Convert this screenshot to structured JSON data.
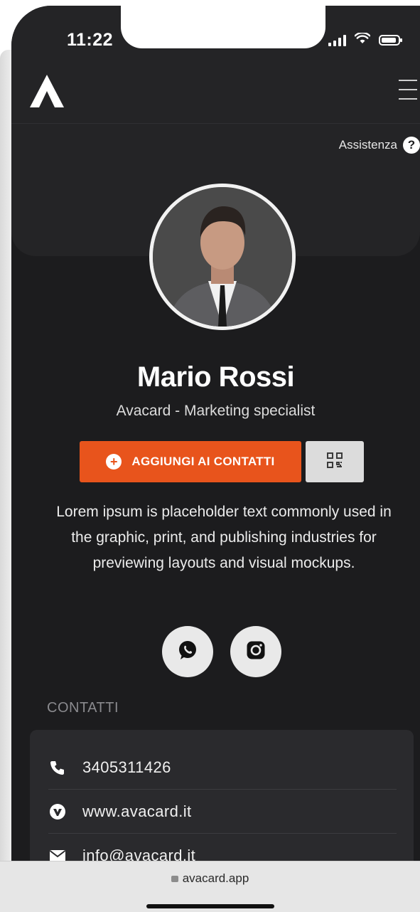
{
  "status_bar": {
    "time": "11:22"
  },
  "header": {
    "help_label": "Assistenza",
    "help_glyph": "?"
  },
  "profile": {
    "name": "Mario Rossi",
    "subtitle": "Avacard - Marketing specialist",
    "add_contact_label": "AGGIUNGI AI CONTATTI",
    "bio": "Lorem ipsum is placeholder text commonly used in the graphic, print, and publishing industries for previewing layouts and visual mockups."
  },
  "contacts": {
    "section_label": "CONTATTI",
    "items": [
      {
        "icon": "phone-icon",
        "value": "3405311426"
      },
      {
        "icon": "web-icon",
        "value": "www.avacard.it"
      },
      {
        "icon": "mail-icon",
        "value": "info@avacard.it"
      }
    ]
  },
  "browser": {
    "url": "avacard.app"
  },
  "colors": {
    "accent": "#e8541c",
    "background": "#1c1c1e",
    "surface": "#242426"
  }
}
